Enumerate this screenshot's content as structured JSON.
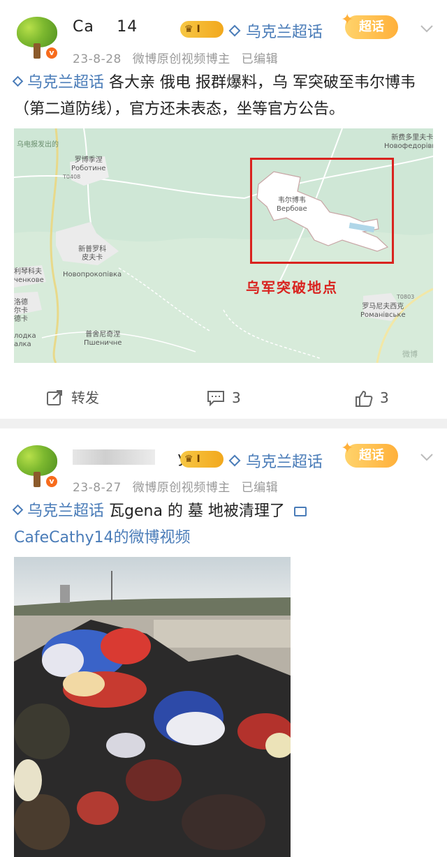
{
  "posts": [
    {
      "username": "Ca      14",
      "badge_text": "I",
      "topic_chip": "乌克兰超话",
      "super_tag": "超话",
      "meta": {
        "date": "23-8-28",
        "source": "微博原创视频博主",
        "edited": "已编辑"
      },
      "text_topic": "乌克兰超话",
      "text_body": "各大亲 俄电 报群爆料，乌 军突破至韦尔博韦（第二道防线），官方还未表态，坐等官方公告。",
      "map": {
        "corner_label": "乌电报发出的",
        "labels": [
          {
            "zh": "罗博季涅",
            "ru": "Роботине"
          },
          {
            "zh": "新普罗科\n皮夫卡",
            "ru": "Новопрокопівка"
          },
          {
            "zh": "韦尔博韦",
            "ru": "Вербове"
          },
          {
            "zh": "新费多里夫卡",
            "ru": "Новофедорівка"
          },
          {
            "zh": "罗马尼夫西克",
            "ru": "Романівське"
          },
          {
            "zh": "普舍尼奇涅",
            "ru": "Пшеничне"
          },
          {
            "zh": "利琴科夫",
            "ru": "ченкове"
          },
          {
            "zh": "洛德\n尔卡\n德卡",
            "ru": "лодка\nалка"
          }
        ],
        "road_labels": [
          "T0408",
          "T0803"
        ],
        "highlight": "乌军突破地点",
        "watermark": "微博"
      },
      "actions": {
        "repost": "转发",
        "comments": "3",
        "likes": "3"
      }
    },
    {
      "username": "      y14",
      "badge_text": "I",
      "topic_chip": "乌克兰超话",
      "super_tag": "超话",
      "meta": {
        "date": "23-8-27",
        "source": "微博原创视频博主",
        "edited": "已编辑"
      },
      "text_topic": "乌克兰超话",
      "text_body": "瓦gena 的 墓  地被清理了",
      "video_link": "CafeCathy14的微博视频"
    }
  ],
  "colors": {
    "link": "#4a7cb8",
    "highlight": "#d9231f",
    "badge": "#f2a81d",
    "map_bg": "#cfe7d6"
  },
  "icons": [
    "tree-avatar-icon",
    "verified-v-icon",
    "crown-icon",
    "diamond-topic-icon",
    "chevron-down-icon",
    "repost-icon",
    "comment-icon",
    "like-icon",
    "video-link-icon"
  ]
}
